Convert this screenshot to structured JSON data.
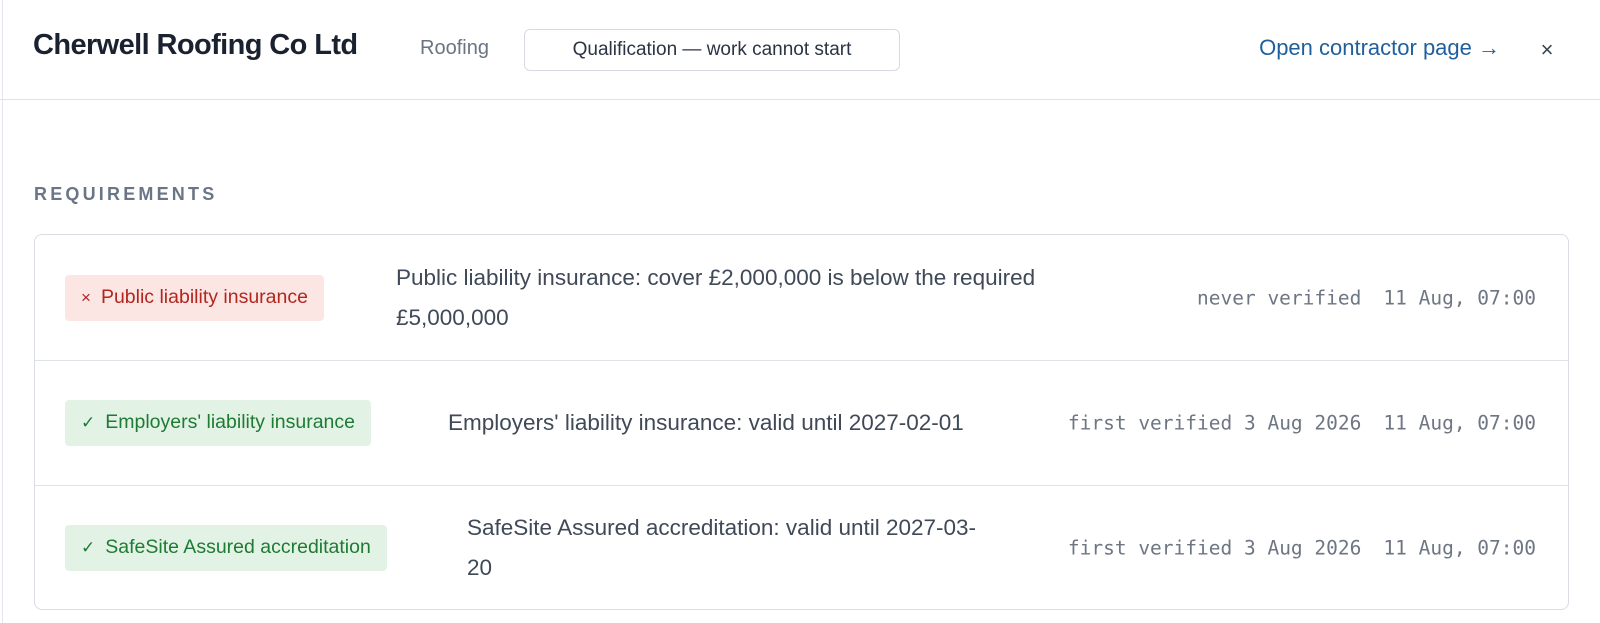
{
  "header": {
    "title": "Cherwell Roofing Co Ltd",
    "category": "Roofing",
    "status": "Qualification — work cannot start",
    "open_link": "Open contractor page →",
    "close_glyph": "×"
  },
  "section_label": "REQUIREMENTS",
  "requirements": [
    {
      "badge_mark": "×",
      "badge_label": "Public liability insurance",
      "status": "fail",
      "detail": "Public liability insurance: cover £2,000,000 is below the required £5,000,000",
      "verified": "never verified",
      "checked": "11 Aug, 07:00"
    },
    {
      "badge_mark": "✓",
      "badge_label": "Employers' liability insurance",
      "status": "pass",
      "detail": "Employers' liability insurance: valid until 2027-02-01",
      "verified": "first verified 3 Aug 2026",
      "checked": "11 Aug, 07:00"
    },
    {
      "badge_mark": "✓",
      "badge_label": "SafeSite Assured accreditation",
      "status": "pass",
      "detail": "SafeSite Assured accreditation: valid until 2027-03-20",
      "verified": "first verified 3 Aug 2026",
      "checked": "11 Aug, 07:00"
    }
  ],
  "colors": {
    "fail_text": "#b3261e",
    "fail_bg": "#fbe6e4",
    "pass_text": "#1f7a33",
    "pass_bg": "#e2f3e6",
    "link": "#1f5f9e"
  }
}
